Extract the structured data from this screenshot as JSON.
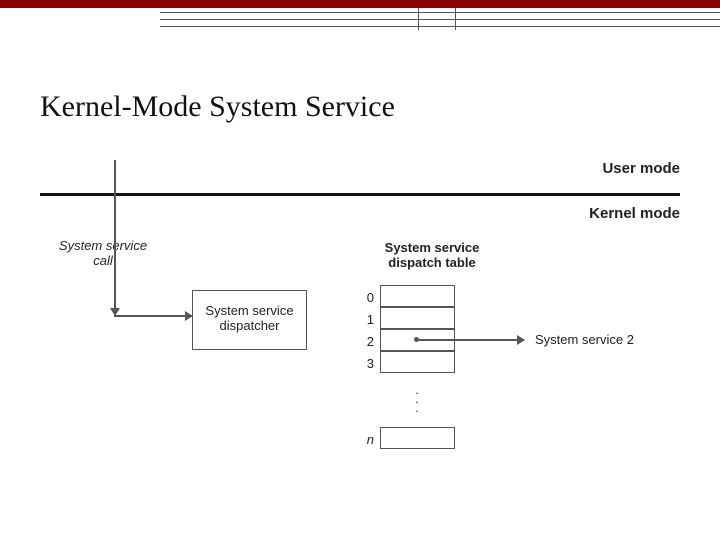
{
  "title": "Kernel-Mode System Service",
  "modes": {
    "user": "User mode",
    "kernel": "Kernel mode"
  },
  "labels": {
    "call": "System service call",
    "dispatcher": "System service dispatcher",
    "table_title": "System service dispatch table",
    "service2": "System service 2"
  },
  "table": {
    "indices": [
      "0",
      "1",
      "2",
      "3"
    ],
    "n_label": "n"
  },
  "colors": {
    "accent": "#8b0000",
    "line": "#555555",
    "text": "#222222"
  }
}
